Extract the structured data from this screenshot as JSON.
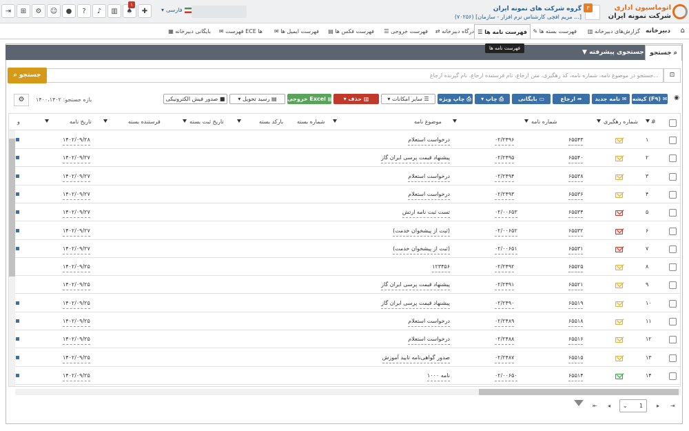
{
  "header": {
    "org_title": "گروه شرکت های نمونه ایران",
    "user_line": "(۷۰۲۵۶) [مریم افچی کارشناس نرم افزار - سازمان ...]",
    "brand_line1": "اتوماسیون اداری",
    "brand_line2": "شرکت نمونه ایران",
    "logo_badge": "۳",
    "language": "فارسی",
    "notif_badge": "۱",
    "icons": [
      "exit-icon",
      "org-chart-icon",
      "settings-icon",
      "users-icon",
      "chat-icon",
      "help-icon",
      "mic-icon",
      "chart-icon",
      "bell-icon",
      "puzzle-icon"
    ]
  },
  "nav": {
    "title": "دبیرخانه",
    "items": [
      {
        "label": "گزارش‌های دبیرخانه"
      },
      {
        "label": "فهرست بسته ها"
      },
      {
        "label": "فهرست نامه ها"
      },
      {
        "label": "درگاه دبیرخانه"
      },
      {
        "label": "فهرست خروجی"
      },
      {
        "label": "فهرست فکس ها"
      },
      {
        "label": "فهرست ایمیل ها"
      },
      {
        "label": "فهرست ECE ها"
      },
      {
        "label": "بایگانی دبیرخانه"
      }
    ],
    "tooltip": "فهرست نامه ها"
  },
  "search": {
    "tab_label": "جستجو",
    "advanced_label": "جستجوی پیشرفته",
    "placeholder": "جستجو در موضوع نامه، شماره نامه، کد رهگیری، متن ارجاع، نام فرستنده ارجاع، نام گیرنده ارجاع...",
    "button_label": "جستجو"
  },
  "toolbar": {
    "draft": "کپشه (F۹)",
    "new_letter": "نامه جدید",
    "refer": "ارجاع",
    "archive": "بایگانی",
    "print": "چاپ",
    "special_print": "چاپ ویژه",
    "other": "سایر امکانات",
    "delete": "حذف",
    "excel": "خروجی Excel",
    "receipt": "رسید تحویل",
    "einvoice": "صدور فیش الکترونیکی",
    "range": "بازه جستجو: ۱۴۰۰،۱۴۰۲"
  },
  "table": {
    "columns": [
      "#",
      "شماره رهگیری",
      "شماره نامه",
      "موضوع نامه",
      "شماره بسته",
      "بارکد بسته",
      "تاریخ ثبت بسته",
      "فرستنده بسته",
      "تاریخ نامه",
      "و"
    ],
    "rows": [
      {
        "n": "۱",
        "track": "۶۵۵۴۳",
        "num": "۰۲/۲۴۹۶",
        "subject": "درخواست استعلام",
        "date": "۱۴۰۲/۰۹/۲۸",
        "env": "y",
        "mark": true
      },
      {
        "n": "۲",
        "track": "۶۵۵۴۰",
        "num": "۰۲/۲۴۹۵",
        "subject": "پیشنهاد قیمت پرسی ایران گاز",
        "date": "۱۴۰۲/۰۹/۲۷",
        "env": "y",
        "mark": true
      },
      {
        "n": "۳",
        "track": "۶۵۵۳۸",
        "num": "۰۲/۲۴۹۴",
        "subject": "درخواست استعلام",
        "date": "۱۴۰۲/۰۹/۲۷",
        "env": "y",
        "mark": true
      },
      {
        "n": "۴",
        "track": "۶۵۵۳۶",
        "num": "۰۲/۲۴۹۳",
        "subject": "درخواست استعلام",
        "date": "۱۴۰۲/۰۹/۲۷",
        "env": "y",
        "mark": true
      },
      {
        "n": "۵",
        "track": "۶۵۵۳۴",
        "num": "۰۲/۰۰۶۵۳",
        "subject": "تست ثبت نامه ارتش",
        "date": "۱۴۰۲/۰۹/۲۷",
        "env": "r",
        "mark": true
      },
      {
        "n": "۶",
        "track": "۶۵۵۳۲",
        "num": "۰۲/۰۰۶۵۲",
        "subject": "(ثبت از پیشخوان خدمت)",
        "date": "۱۴۰۲/۰۹/۲۷",
        "env": "r",
        "mark": true
      },
      {
        "n": "۷",
        "track": "۶۵۵۳۱",
        "num": "۰۲/۰۰۶۵۱",
        "subject": "(ثبت از پیشخوان خدمت)",
        "date": "۱۴۰۲/۰۹/۲۷",
        "env": "r",
        "mark": true
      },
      {
        "n": "۸",
        "track": "۶۵۵۲۵",
        "num": "۰۲/۲۴۹۲",
        "subject": "۱۲۳۴۵۶",
        "date": "۱۴۰۲/۰۹/۲۵",
        "env": "y",
        "mark": false
      },
      {
        "n": "۹",
        "track": "۶۵۵۲۱",
        "num": "۰۲/۲۴۹۱",
        "subject": "پیشنهاد قیمت پرسی ایران گاز",
        "date": "۱۴۰۲/۰۹/۲۵",
        "env": "y",
        "mark": false
      },
      {
        "n": "۱۰",
        "track": "۶۵۵۱۹",
        "num": "۰۲/۲۴۹۰",
        "subject": "پیشنهاد قیمت پرسی ایران گاز",
        "date": "۱۴۰۲/۰۹/۲۵",
        "env": "y",
        "mark": true
      },
      {
        "n": "۱۱",
        "track": "۶۵۵۱۸",
        "num": "۰۲/۲۴۸۹",
        "subject": "درخواست استعلام",
        "date": "۱۴۰۲/۰۹/۲۵",
        "env": "y",
        "mark": true
      },
      {
        "n": "۱۲",
        "track": "۶۵۵۱۶",
        "num": "۰۲/۲۴۸۸",
        "subject": "درخواست استعلام",
        "date": "۱۴۰۲/۰۹/۲۵",
        "env": "y",
        "mark": true
      },
      {
        "n": "۱۳",
        "track": "۶۵۵۱۵",
        "num": "۰۲/۲۴۸۷",
        "subject": "صدور گواهی‌نامه تایید آموزش",
        "date": "۱۴۰۲/۰۹/۲۵",
        "env": "y",
        "mark": true
      },
      {
        "n": "۱۴",
        "track": "۶۵۵۱۴",
        "num": "۰۲/۰۰۶۵۰",
        "subject": "نامه ۱۰۰۰",
        "date": "۱۴۰۲/۰۹/۲۵",
        "env": "g",
        "mark": true
      }
    ]
  },
  "pager": {
    "page": "1"
  },
  "colors": {
    "accent": "#3a6fa8",
    "search": "#d59a1a",
    "danger": "#c0392b",
    "excel": "#5aa35a",
    "darkbar": "#5c6470"
  }
}
